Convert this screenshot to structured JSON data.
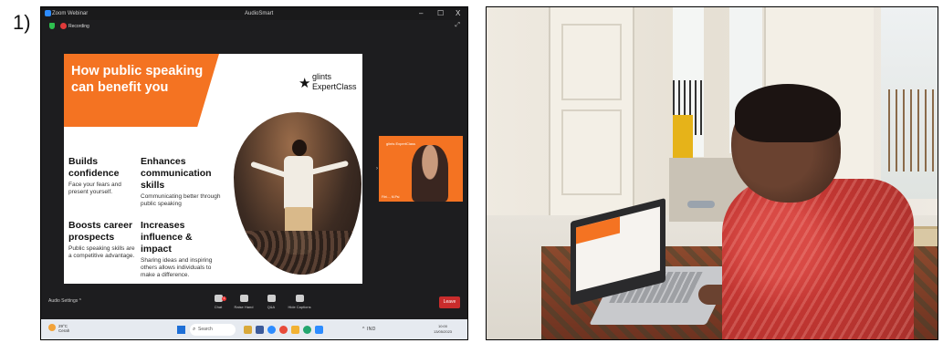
{
  "figure_label": "1)",
  "zoom_window": {
    "app_title": "Zoom Webinar",
    "center_title": "AudioSmart",
    "recording_label": "Recording",
    "controls": {
      "minimize": "–",
      "maximize": "☐",
      "close": "X"
    },
    "slide": {
      "title": "How public speaking can benefit you",
      "brand_line1": "glints",
      "brand_line2": "ExpertClass",
      "points": [
        {
          "heading": "Builds confidence",
          "desc": "Face your fears and present yourself."
        },
        {
          "heading": "Enhances communication skills",
          "desc": "Communicating better through public speaking"
        },
        {
          "heading": "Boosts career prospects",
          "desc": "Public speaking skills are a competitive advantage."
        },
        {
          "heading": "Increases influence & impact",
          "desc": "Sharing ideas and inspiring others allows individuals to make a difference."
        }
      ]
    },
    "participant": {
      "logo": "glints ExpertClass",
      "name": "Fitri..., M.Psi"
    },
    "toolbar": {
      "audio_settings": "Audio Settings ^",
      "items": [
        {
          "label": "Chat",
          "icon": "chat-icon",
          "badge": "1"
        },
        {
          "label": "Raise Hand",
          "icon": "raise-hand-icon"
        },
        {
          "label": "Q&A",
          "icon": "qa-icon"
        },
        {
          "label": "Hide Captions",
          "icon": "captions-icon"
        }
      ],
      "leave": "Leave"
    },
    "taskbar": {
      "weather_temp": "29°C",
      "weather_desc": "Cerah",
      "search": "Search",
      "tray": "^ IND",
      "time": "10:00",
      "date": "13/05/2023"
    }
  },
  "colors": {
    "accent": "#f47322",
    "leave": "#c92c2c",
    "zoom_blue": "#2d8cff"
  }
}
